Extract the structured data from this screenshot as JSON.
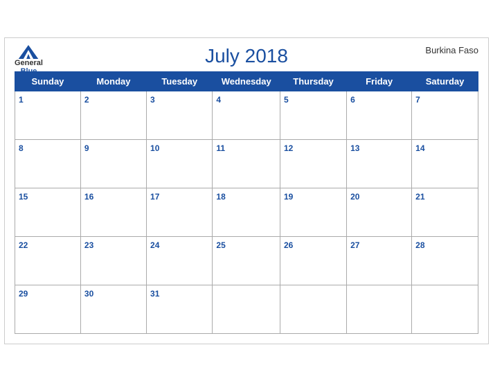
{
  "header": {
    "logo_general": "General",
    "logo_blue": "Blue",
    "title": "July 2018",
    "country": "Burkina Faso"
  },
  "weekdays": [
    "Sunday",
    "Monday",
    "Tuesday",
    "Wednesday",
    "Thursday",
    "Friday",
    "Saturday"
  ],
  "weeks": [
    [
      {
        "day": "1",
        "empty": false
      },
      {
        "day": "2",
        "empty": false
      },
      {
        "day": "3",
        "empty": false
      },
      {
        "day": "4",
        "empty": false
      },
      {
        "day": "5",
        "empty": false
      },
      {
        "day": "6",
        "empty": false
      },
      {
        "day": "7",
        "empty": false
      }
    ],
    [
      {
        "day": "8",
        "empty": false
      },
      {
        "day": "9",
        "empty": false
      },
      {
        "day": "10",
        "empty": false
      },
      {
        "day": "11",
        "empty": false
      },
      {
        "day": "12",
        "empty": false
      },
      {
        "day": "13",
        "empty": false
      },
      {
        "day": "14",
        "empty": false
      }
    ],
    [
      {
        "day": "15",
        "empty": false
      },
      {
        "day": "16",
        "empty": false
      },
      {
        "day": "17",
        "empty": false
      },
      {
        "day": "18",
        "empty": false
      },
      {
        "day": "19",
        "empty": false
      },
      {
        "day": "20",
        "empty": false
      },
      {
        "day": "21",
        "empty": false
      }
    ],
    [
      {
        "day": "22",
        "empty": false
      },
      {
        "day": "23",
        "empty": false
      },
      {
        "day": "24",
        "empty": false
      },
      {
        "day": "25",
        "empty": false
      },
      {
        "day": "26",
        "empty": false
      },
      {
        "day": "27",
        "empty": false
      },
      {
        "day": "28",
        "empty": false
      }
    ],
    [
      {
        "day": "29",
        "empty": false
      },
      {
        "day": "30",
        "empty": false
      },
      {
        "day": "31",
        "empty": false
      },
      {
        "day": "",
        "empty": true
      },
      {
        "day": "",
        "empty": true
      },
      {
        "day": "",
        "empty": true
      },
      {
        "day": "",
        "empty": true
      }
    ]
  ]
}
